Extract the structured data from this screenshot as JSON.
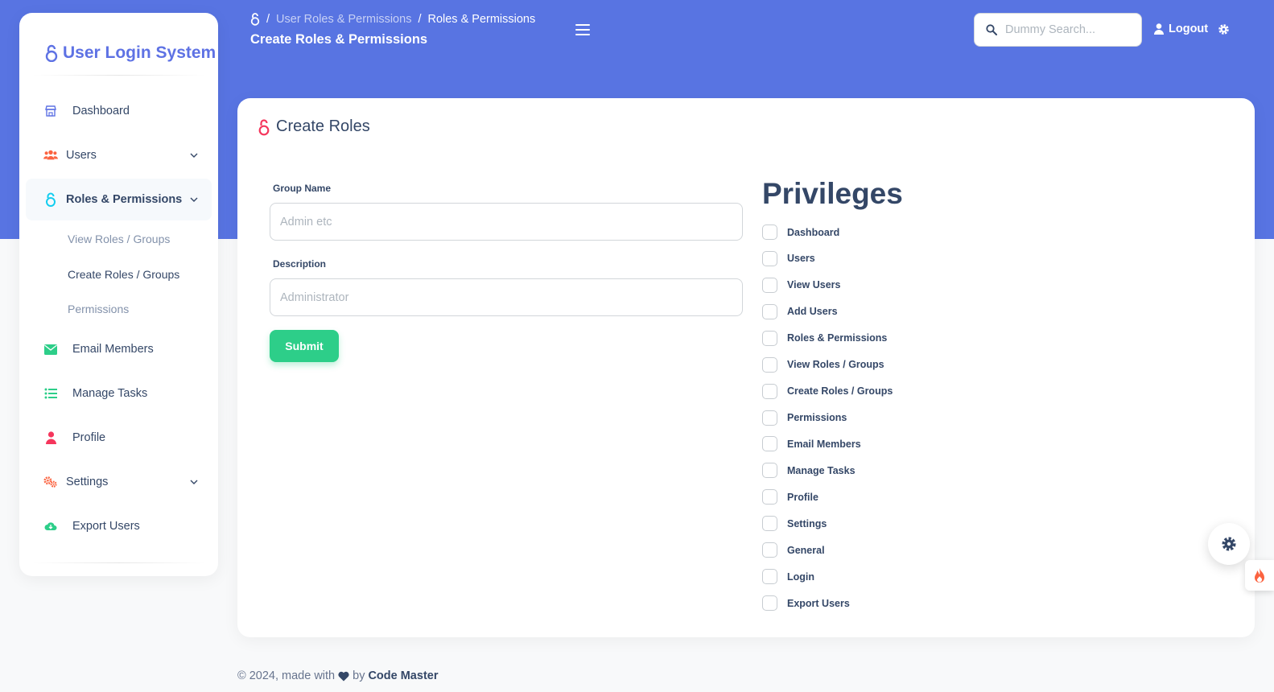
{
  "colors": {
    "primary": "#5e72e4",
    "success": "#2dce89",
    "danger": "#f5365c",
    "text": "#344767"
  },
  "sidebar": {
    "brand": "User Login System",
    "items": [
      {
        "label": "Dashboard",
        "icon": "shop-icon"
      },
      {
        "label": "Users",
        "icon": "users-icon"
      },
      {
        "label": "Roles & Permissions",
        "icon": "lock-icon"
      },
      {
        "label": "Email Members",
        "icon": "envelope-icon"
      },
      {
        "label": "Manage Tasks",
        "icon": "list-icon"
      },
      {
        "label": "Profile",
        "icon": "user-icon"
      },
      {
        "label": "Settings",
        "icon": "gears-icon"
      },
      {
        "label": "Export Users",
        "icon": "cloud-download-icon"
      }
    ],
    "sub_items": [
      "View Roles / Groups",
      "Create Roles / Groups",
      "Permissions"
    ]
  },
  "breadcrumb": {
    "items": [
      "User Roles & Permissions",
      "Roles & Permissions"
    ],
    "sep": "/"
  },
  "header": {
    "title": "Create Roles & Permissions",
    "search_placeholder": "Dummy Search...",
    "logout_label": "Logout"
  },
  "card": {
    "title": "Create Roles",
    "group_label": "Group Name",
    "group_placeholder": "Admin etc",
    "desc_label": "Description",
    "desc_placeholder": "Administrator",
    "submit_label": "Submit"
  },
  "privileges": {
    "title": "Privileges",
    "items": [
      "Dashboard",
      "Users",
      "View Users",
      "Add Users",
      "Roles & Permissions",
      "View Roles / Groups",
      "Create Roles / Groups",
      "Permissions",
      "Email Members",
      "Manage Tasks",
      "Profile",
      "Settings",
      "General",
      "Login",
      "Export Users"
    ]
  },
  "footer": {
    "prefix": "© 2024, made with",
    "by": "by",
    "author": "Code Master"
  }
}
